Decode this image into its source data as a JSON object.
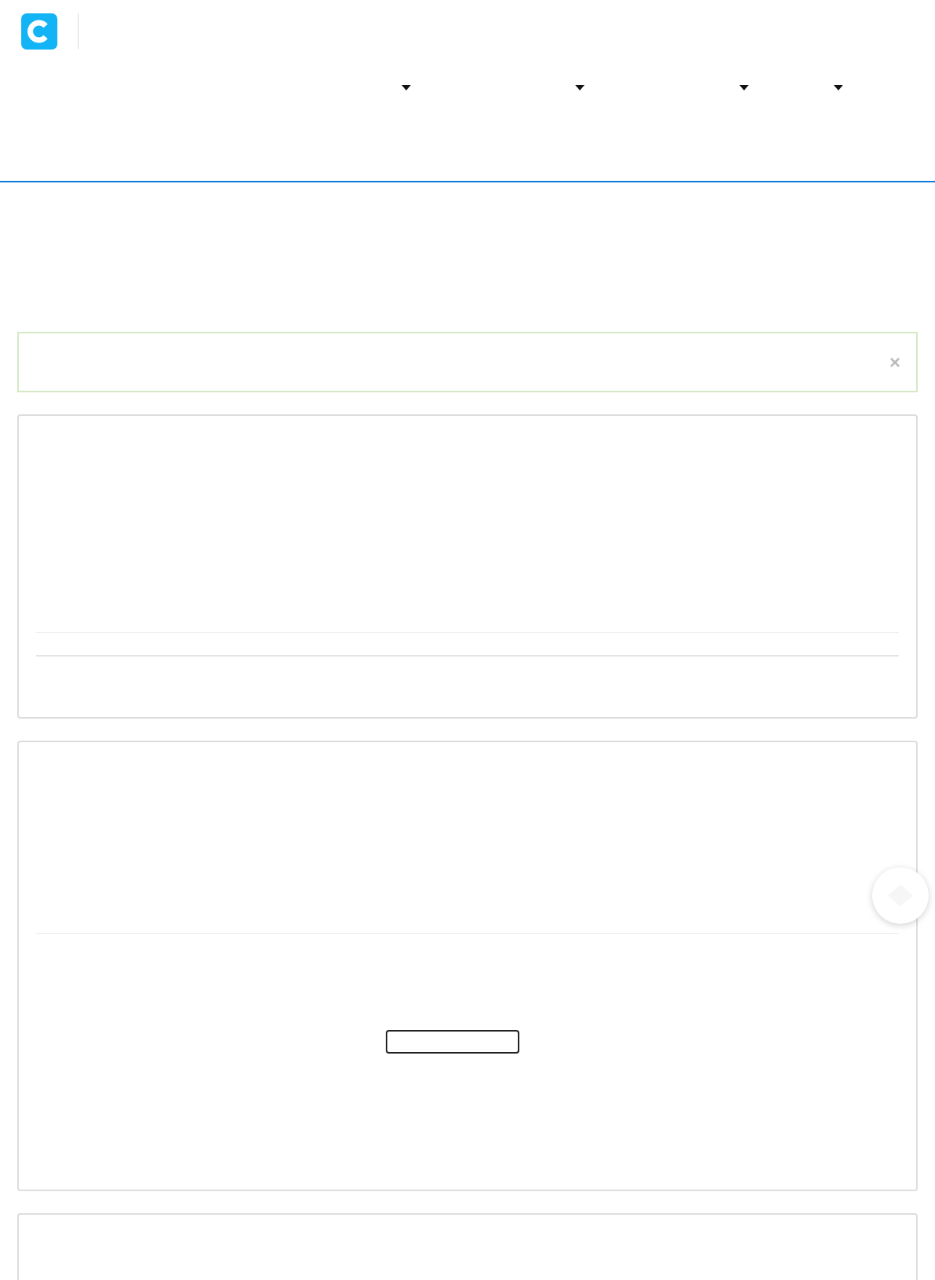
{
  "nav": {
    "menus": [
      {
        "kind": "dropdown"
      },
      {
        "kind": "dropdown"
      },
      {
        "kind": "dropdown"
      },
      {
        "kind": "dropdown"
      }
    ]
  },
  "alert": {
    "close": "×"
  },
  "cards": [
    {
      "kind": "list"
    },
    {
      "kind": "action"
    },
    {
      "kind": "plain"
    }
  ]
}
